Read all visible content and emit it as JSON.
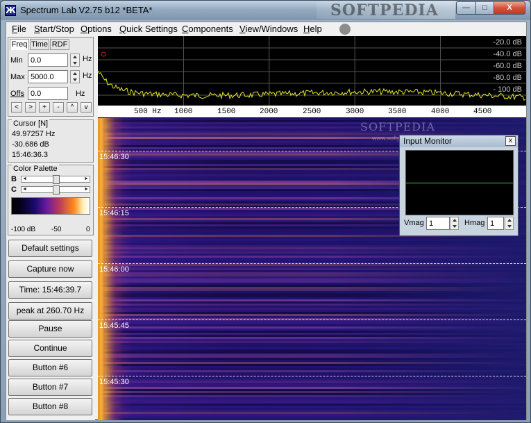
{
  "window": {
    "title": "Spectrum Lab V2.75 b12 *BETA*",
    "watermark": "SOFTPEDIA",
    "min_label": "—",
    "max_label": "□",
    "close_label": "X"
  },
  "menu": {
    "items": [
      {
        "key": "F",
        "rest": "ile"
      },
      {
        "key": "S",
        "rest": "tart/Stop"
      },
      {
        "key": "O",
        "rest": "ptions"
      },
      {
        "key": "Q",
        "rest": "uick Settings"
      },
      {
        "key": "C",
        "rest": "omponents"
      },
      {
        "key": "V",
        "rest": "iew/Windows"
      },
      {
        "key": "H",
        "rest": "elp"
      }
    ]
  },
  "freq_panel": {
    "tabs": [
      "Freq",
      "Time",
      "RDF"
    ],
    "min_label": "Min",
    "min_value": "0.0",
    "max_label": "Max",
    "max_value": "5000.0",
    "offs_label": "Offs",
    "offs_value": "0.0",
    "unit": "Hz",
    "nav_buttons": [
      "<",
      ">",
      "+",
      "-",
      "^",
      "v"
    ]
  },
  "cursor": {
    "title": "Cursor [N]",
    "frequency": "49.97257 Hz",
    "level": "-30.686 dB",
    "time": "15:46:36.3"
  },
  "palette": {
    "title": "Color Palette",
    "b_label": "B",
    "c_label": "C",
    "b_level": 0.5,
    "c_level": 0.5,
    "scale": [
      "-100 dB",
      "-50",
      "0"
    ]
  },
  "buttons": [
    "Default settings",
    "Capture now",
    "Time:  15:46:39.7",
    "peak at 260.70 Hz",
    "Pause",
    "Continue",
    "Button #6",
    "Button #7",
    "Button #8"
  ],
  "spectrum": {
    "db_labels": [
      "-20.0 dB",
      "-40.0 dB",
      "-60.0 dB",
      "-80.0 dB",
      "- 100 dB"
    ],
    "freq_labels": [
      "500 Hz",
      "1000",
      "1500",
      "2000",
      "2500",
      "3000",
      "3500",
      "4000",
      "4500"
    ],
    "trace_color": "#e8e830"
  },
  "waterfall": {
    "time_labels": [
      "15:46:30",
      "15:46:15",
      "15:46:00",
      "15:45:45",
      "15:45:30"
    ],
    "watermark": "SOFTPEDIA",
    "watermark_small": "www.softpedia.com"
  },
  "input_monitor": {
    "title": "Input Monitor",
    "close_label": "x",
    "vmag_label": "Vmag",
    "vmag_value": "1",
    "hmag_label": "Hmag",
    "hmag_value": "1",
    "trace_color": "#3cd23c"
  }
}
